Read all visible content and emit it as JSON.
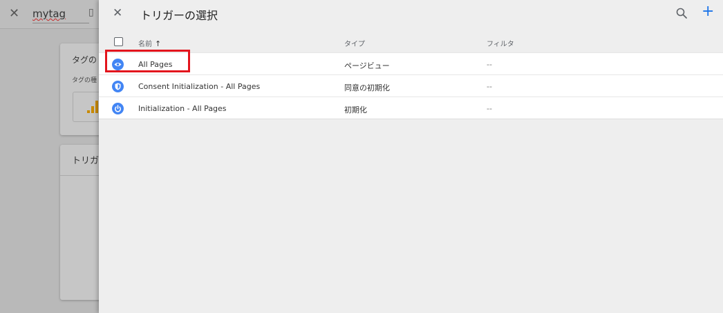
{
  "background": {
    "tag_name": "mytag",
    "card1_title": "タグの",
    "card1_subtitle": "タグの種",
    "card2_title": "トリガ"
  },
  "panel": {
    "title": "トリガーの選択",
    "columns": {
      "name": "名前",
      "type": "タイプ",
      "filter": "フィルタ"
    },
    "sort_arrow": "↑",
    "rows": [
      {
        "name": "All Pages",
        "type": "ページビュー",
        "filter": "--",
        "icon": "eye-icon"
      },
      {
        "name": "Consent Initialization - All Pages",
        "type": "同意の初期化",
        "filter": "--",
        "icon": "shield-icon"
      },
      {
        "name": "Initialization - All Pages",
        "type": "初期化",
        "filter": "--",
        "icon": "power-icon"
      }
    ]
  },
  "colors": {
    "accent": "#1a73e8",
    "icon_bg": "#4285f4",
    "highlight": "#e3141c"
  }
}
